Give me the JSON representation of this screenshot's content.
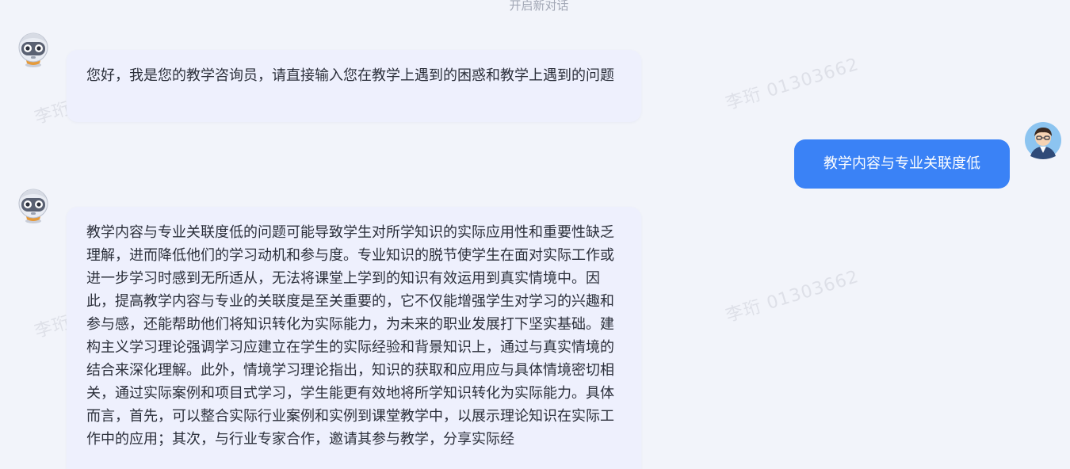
{
  "header": {
    "new_chat_label": "开启新对话"
  },
  "watermark": {
    "text": "李珩 01303662"
  },
  "messages": [
    {
      "role": "assistant",
      "text": "您好，我是您的教学咨询员，请直接输入您在教学上遇到的困惑和教学上遇到的问题"
    },
    {
      "role": "user",
      "text": "教学内容与专业关联度低"
    },
    {
      "role": "assistant",
      "text": "教学内容与专业关联度低的问题可能导致学生对所学知识的实际应用性和重要性缺乏理解，进而降低他们的学习动机和参与度。专业知识的脱节使学生在面对实际工作或进一步学习时感到无所适从，无法将课堂上学到的知识有效运用到真实情境中。因此，提高教学内容与专业的关联度是至关重要的，它不仅能增强学生对学习的兴趣和参与感，还能帮助他们将知识转化为实际能力，为未来的职业发展打下坚实基础。建构主义学习理论强调学习应建立在学生的实际经验和背景知识上，通过与真实情境的结合来深化理解。此外，情境学习理论指出，知识的获取和应用应与具体情境密切相关，通过实际案例和项目式学习，学生能更有效地将所学知识转化为实际能力。具体而言，首先，可以整合实际行业案例和实例到课堂教学中，以展示理论知识在实际工作中的应用；其次，与行业专家合作，邀请其参与教学，分享实际经"
    }
  ],
  "colors": {
    "background": "#f2f4fa",
    "bot_bubble": "#eef0fd",
    "user_bubble": "#3a82f6",
    "user_text": "#ffffff",
    "bot_text": "#2b2f3a"
  },
  "icons": {
    "assistant_avatar": "robot-avatar-icon",
    "user_avatar": "user-avatar-icon"
  }
}
